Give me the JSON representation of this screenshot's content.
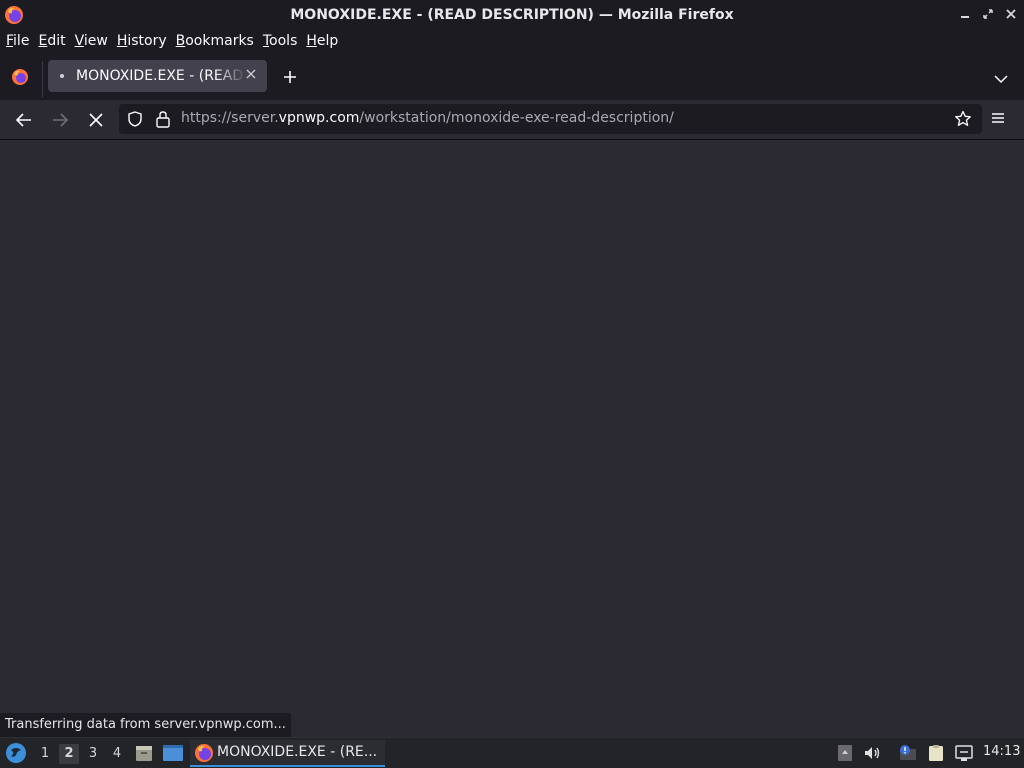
{
  "window": {
    "title": "MONOXIDE.EXE - (READ DESCRIPTION) — Mozilla Firefox"
  },
  "menubar": {
    "items": [
      {
        "label": "File",
        "accel": "F",
        "rest": "ile"
      },
      {
        "label": "Edit",
        "accel": "E",
        "rest": "dit"
      },
      {
        "label": "View",
        "accel": "V",
        "rest": "iew"
      },
      {
        "label": "History",
        "accel": "H",
        "rest": "istory"
      },
      {
        "label": "Bookmarks",
        "accel": "B",
        "rest": "ookmarks"
      },
      {
        "label": "Tools",
        "accel": "T",
        "rest": "ools"
      },
      {
        "label": "Help",
        "accel": "H",
        "rest": "elp"
      }
    ]
  },
  "tabs": [
    {
      "label": "MONOXIDE.EXE - (READ DESCRIPTION)",
      "loading": true,
      "active": true
    }
  ],
  "navbar": {
    "url_prefix": "https://server.",
    "url_host": "vpnwp.com",
    "url_path": "/workstation/monoxide-exe-read-description/",
    "loading": true
  },
  "status": {
    "text": "Transferring data from server.vpnwp.com..."
  },
  "taskbar": {
    "workspaces": [
      "1",
      "2",
      "3",
      "4"
    ],
    "active_workspace": "2",
    "task_label": "MONOXIDE.EXE - (RE...",
    "clock": "14:13"
  },
  "colors": {
    "accent": "#3d8fd8",
    "content_bg": "#2b2a33",
    "chrome_bg": "#1c1b22"
  }
}
